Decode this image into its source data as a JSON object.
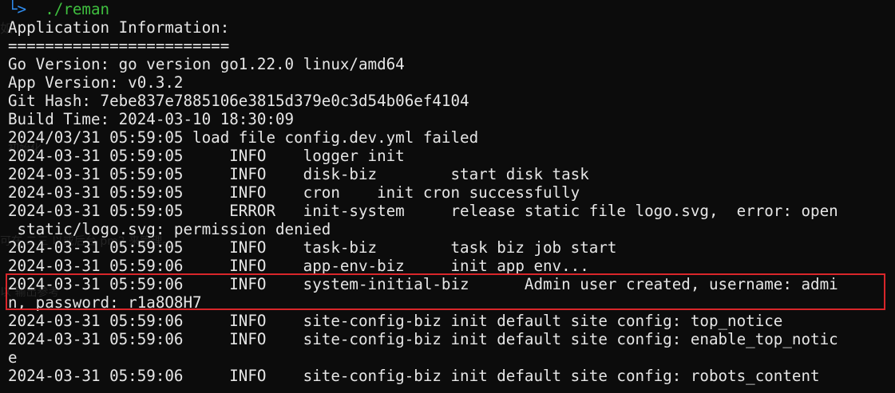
{
  "prompt": {
    "arrow": "└>",
    "command": "./reman"
  },
  "lines": [
    "Application Information:",
    "========================",
    "Go Version: go version go1.22.0 linux/amd64",
    "App Version: v0.3.2",
    "Git Hash: 7ebe837e7885106e3815d379e0c3d54b06ef4104",
    "Build Time: 2024-03-10 18:30:09",
    "2024/03/31 05:59:05 load file config.dev.yml failed",
    "2024-03-31 05:59:05     INFO    logger init",
    "2024-03-31 05:59:05     INFO    disk-biz        start disk task",
    "2024-03-31 05:59:05     INFO    cron    init cron successfully",
    "2024-03-31 05:59:05     ERROR   init-system     release static file logo.svg,  error: open",
    " static/logo.svg: permission denied",
    "2024-03-31 05:59:05     INFO    task-biz        task biz job start",
    "2024-03-31 05:59:06     INFO    app-env-biz     init app env...",
    "2024-03-31 05:59:06     INFO    system-initial-biz      Admin user created, username: admi",
    "n, password: r1a8O8H7",
    "2024-03-31 05:59:06     INFO    site-config-biz init default site config: top_notice",
    "2024-03-31 05:59:06     INFO    site-config-biz init default site config: enable_top_notic",
    "e",
    "2024-03-31 05:59:06     INFO    site-config-biz init default site config: robots_content"
  ]
}
